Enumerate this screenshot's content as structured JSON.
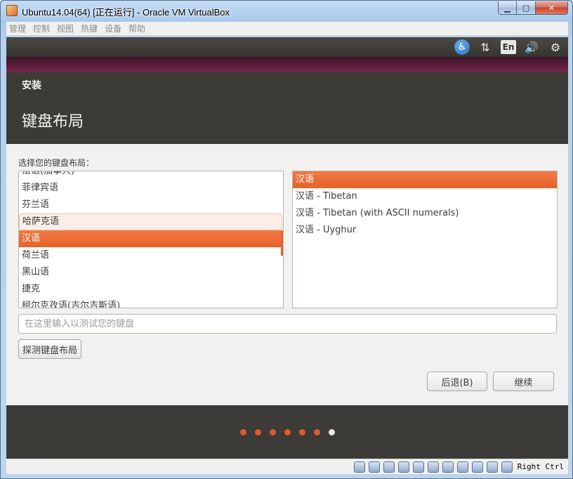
{
  "window": {
    "title": "Ubuntu14.04(64) [正在运行] - Oracle VM VirtualBox",
    "buttons": {
      "minimize": "▁",
      "maximize": "□",
      "close": "✕"
    }
  },
  "menubar": {
    "items": [
      "管理",
      "控制",
      "视图",
      "热键",
      "设备",
      "帮助"
    ]
  },
  "panel": {
    "language": "En"
  },
  "installer": {
    "header": "安装",
    "title": "键盘布局",
    "prompt": "选择您的键盘布局：",
    "layouts": [
      "法语(加拿大)",
      "菲律宾语",
      "芬兰语",
      "哈萨克语",
      "汉语",
      "荷兰语",
      "黑山语",
      "捷克",
      "柯尔克孜语(吉尔吉斯语)"
    ],
    "selected_layout": "汉语",
    "hovered_layout": "哈萨克语",
    "variants": [
      "汉语",
      "汉语 - Tibetan",
      "汉语 - Tibetan (with ASCII numerals)",
      "汉语 - Uyghur"
    ],
    "selected_variant": "汉语",
    "test_placeholder": "在这里输入以测试您的键盘",
    "detect_button": "探测键盘布局",
    "back_button": "后退(B)",
    "continue_button": "继续",
    "progress": {
      "total_steps": 7,
      "current_step": 7
    }
  },
  "statusbar": {
    "host_key": "Right Ctrl"
  },
  "colors": {
    "accent": "#e5622a",
    "installer_bg": "#3c3b37",
    "content_bg": "#f2f1f0"
  }
}
